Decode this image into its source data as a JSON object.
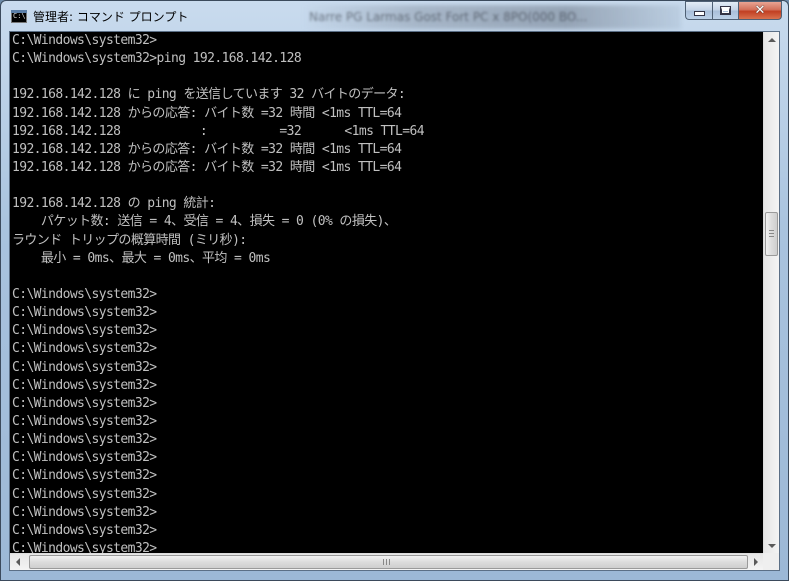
{
  "window": {
    "title": "管理者: コマンド プロンプト",
    "icon": "console-icon",
    "icon_text": "C:\\."
  },
  "background_blur_text": "Narre  PG  Larmas Gost  Fort  PC x 8PO(000 BO...",
  "caption_buttons": {
    "minimize": "minimize-icon",
    "maximize": "maximize-icon",
    "close": "close-icon",
    "close_glyph": "✕"
  },
  "console": {
    "text_color": "#c0c0c0",
    "background_color": "#000000",
    "lines": [
      "C:\\Windows\\system32>",
      "C:\\Windows\\system32>ping 192.168.142.128",
      "",
      "192.168.142.128 に ping を送信しています 32 バイトのデータ:",
      "192.168.142.128 からの応答: バイト数 =32 時間 <1ms TTL=64",
      "192.168.142.128           :          =32      <1ms TTL=64",
      "192.168.142.128 からの応答: バイト数 =32 時間 <1ms TTL=64",
      "192.168.142.128 からの応答: バイト数 =32 時間 <1ms TTL=64",
      "",
      "192.168.142.128 の ping 統計:",
      "    パケット数: 送信 = 4、受信 = 4、損失 = 0 (0% の損失)、",
      "ラウンド トリップの概算時間 (ミリ秒):",
      "    最小 = 0ms、最大 = 0ms、平均 = 0ms",
      "",
      "C:\\Windows\\system32>",
      "C:\\Windows\\system32>",
      "C:\\Windows\\system32>",
      "C:\\Windows\\system32>",
      "C:\\Windows\\system32>",
      "C:\\Windows\\system32>",
      "C:\\Windows\\system32>",
      "C:\\Windows\\system32>",
      "C:\\Windows\\system32>",
      "C:\\Windows\\system32>",
      "C:\\Windows\\system32>",
      "C:\\Windows\\system32>",
      "C:\\Windows\\system32>",
      "C:\\Windows\\system32>",
      "C:\\Windows\\system32>"
    ]
  },
  "scrollbars": {
    "vertical_position": 0.36,
    "horizontal_position": 0.0
  }
}
